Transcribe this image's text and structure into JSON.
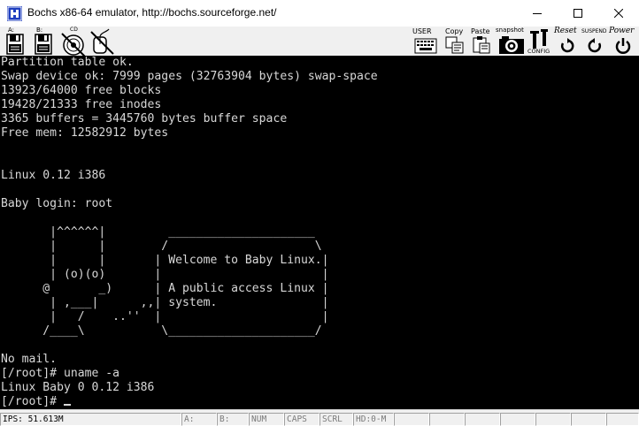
{
  "window": {
    "title": "Bochs x86-64 emulator, http://bochs.sourceforge.net/",
    "app_icon": "bochs-logo-icon",
    "buttons": [
      "minimize-icon",
      "maximize-icon",
      "close-icon"
    ]
  },
  "toolbar": {
    "floppy_a_label": "A:",
    "floppy_b_label": "B:",
    "cdrom_label": "CD",
    "user_label": "USER",
    "copy_label": "Copy",
    "paste_label": "Paste",
    "snapshot_label": "snapshot",
    "config_label": "CONFIG",
    "reset_label": "Reset",
    "suspend_label": "SUSPEND",
    "power_label": "Power"
  },
  "console": {
    "lines": [
      "Partition table ok.",
      "Swap device ok: 7999 pages (32763904 bytes) swap-space",
      "13923/64000 free blocks",
      "19428/21333 free inodes",
      "3365 buffers = 3445760 bytes buffer space",
      "Free mem: 12582912 bytes",
      "",
      "",
      "Linux 0.12 i386",
      "",
      "Baby login: root",
      "",
      "       |^^^^^^|         _____________________",
      "       |      |        /                     \\",
      "       |      |       | Welcome to Baby Linux.|",
      "       | (o)(o)       |                       |",
      "      @       _)      | A public access Linux |",
      "       | ,___|      ,,| system.               |",
      "       |   /    ..''  |                       |",
      "      /____\\           \\_____________________/",
      "",
      "No mail.",
      "[/root]# uname -a",
      "Linux Baby 0 0.12 i386",
      "[/root]# "
    ]
  },
  "status": {
    "ips": "IPS: 51.613M",
    "a": "A:",
    "b": "B:",
    "num": "NUM",
    "caps": "CAPS",
    "scrl": "SCRL",
    "hd": "HD:0-M"
  },
  "colors": {
    "console_bg": "#000000",
    "console_fg": "#d8d8d8",
    "toolbar_bg": "#f0f0f0",
    "bochs_icon_blue": "#1f3fbf"
  }
}
